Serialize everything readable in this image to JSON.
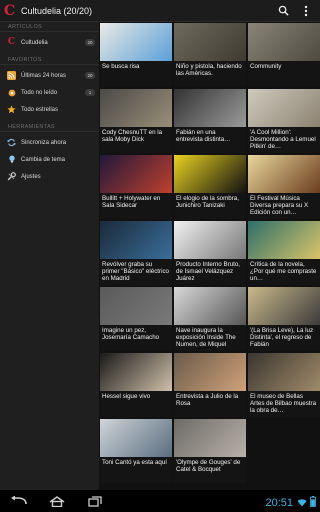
{
  "app": {
    "logo_letter": "C",
    "title": "Cultudelia (20/20)",
    "accent": "#d3233a"
  },
  "actionbar": {
    "search_icon": "search-icon",
    "menu_icon": "overflow-menu-icon"
  },
  "drawer": {
    "articles_header": "ARTÍCULOS",
    "articles": [
      {
        "label": "Cultudelia",
        "count": "20",
        "icon": "cultudelia-logo-icon"
      }
    ],
    "favorites_header": "FAVORITOS",
    "favorites": [
      {
        "label": "Últimas 24 horas",
        "count": "20",
        "icon": "rss-feed-icon"
      },
      {
        "label": "Todo no leído",
        "count": "1",
        "icon": "unread-dot-icon"
      },
      {
        "label": "Todo estrellas",
        "count": "",
        "icon": "star-icon"
      }
    ],
    "tools_header": "HERRAMIENTAS",
    "tools": [
      {
        "label": "Sincroniza ahora",
        "icon": "sync-icon"
      },
      {
        "label": "Cambia de tema",
        "icon": "lightbulb-icon"
      },
      {
        "label": "Ajustes",
        "icon": "wrench-icon"
      }
    ]
  },
  "articles": [
    {
      "title": "Se busca risa",
      "bg": "#e9e9e4",
      "accent": "#5aa0d8"
    },
    {
      "title": "Niño y pistola, haciendo las Américas.",
      "bg": "#6e6a5c",
      "accent": "#3f3b32"
    },
    {
      "title": "Community",
      "bg": "#8a8578",
      "accent": "#4e4a40"
    },
    {
      "title": "Cody ChesnuTT en la sala Moby Dick",
      "bg": "#4a4a48",
      "accent": "#9a8e78"
    },
    {
      "title": "Fabián en una entrevista distinta…",
      "bg": "#333",
      "accent": "#9a9a9a"
    },
    {
      "title": "'A Cool Million': Desmontando a Lemuel Pitkin' de…",
      "bg": "#cfcabd",
      "accent": "#8c8272"
    },
    {
      "title": "Bullitt + Holywater en Sala Sidecar",
      "bg": "#20183a",
      "accent": "#c0402e"
    },
    {
      "title": "El elogio de la sombra, Junichiro Tanizaki",
      "bg": "#e9d21f",
      "accent": "#111"
    },
    {
      "title": "El Festival Música Diversa prepara su X Edición con un…",
      "bg": "#e8d79b",
      "accent": "#6b3d1f"
    },
    {
      "title": "Revólver graba su primer \"Básico\" eléctrico en Madrid",
      "bg": "#1b2a3a",
      "accent": "#3a6e9a"
    },
    {
      "title": "Producto Interno Bruto, de Ismael Velázquez Juárez",
      "bg": "#f1f1f1",
      "accent": "#777"
    },
    {
      "title": "Crítica de la novela, ¿Por qué me compraste un…",
      "bg": "#2d6f6a",
      "accent": "#d9c468"
    },
    {
      "title": "Imagine un pez, Josemaría Camacho",
      "bg": "#5a5a5a",
      "accent": "#7a7a7a"
    },
    {
      "title": "Nave inaugura la exposición Inside The Numen, de Miquel",
      "bg": "#d8d8d8",
      "accent": "#555"
    },
    {
      "title": "'(La Brisa Leve), La luz Distinta', el regreso de Fabián",
      "bg": "#c9b98a",
      "accent": "#3b3b3b"
    },
    {
      "title": "Hessel sigue vivo",
      "bg": "#1a1a1a",
      "accent": "#d0c0aa"
    },
    {
      "title": "Entrevista a Julio de la Rosa",
      "bg": "#6a5a4a",
      "accent": "#cfa27a"
    },
    {
      "title": "El museo de Bellas Artes de Bilbao muestra la obra de…",
      "bg": "#3a3630",
      "accent": "#a08a6a"
    },
    {
      "title": "Toni Cantó ya esta aquí",
      "bg": "#cfd4d8",
      "accent": "#5a6e80"
    },
    {
      "title": "'Olympe de Gouges' de Catel & Bocquet",
      "bg": "#6d6a66",
      "accent": "#b8b2a8"
    }
  ],
  "navbar": {
    "time": "20:51",
    "back_icon": "back-icon",
    "home_icon": "home-icon",
    "recents_icon": "recent-apps-icon"
  }
}
